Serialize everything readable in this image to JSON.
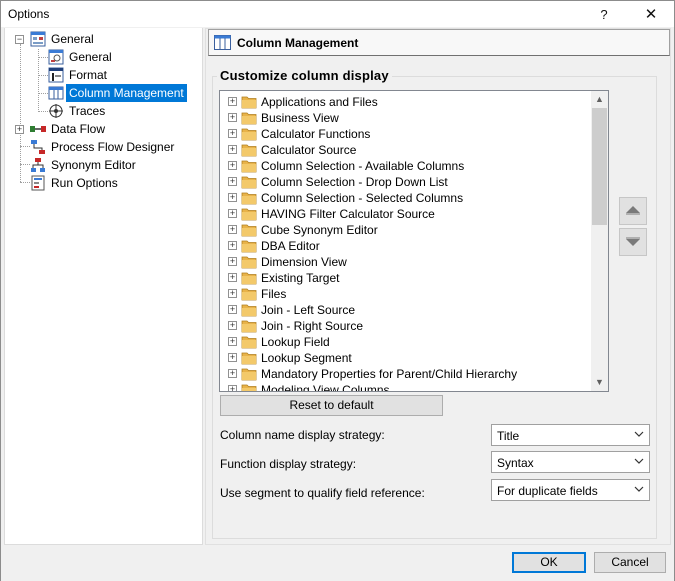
{
  "window": {
    "title": "Options",
    "help_glyph": "?",
    "close_glyph": "✕"
  },
  "tree": {
    "general": "General",
    "general_child": "General",
    "format": "Format",
    "column_management": "Column Management",
    "traces": "Traces",
    "data_flow": "Data Flow",
    "process_flow_designer": "Process Flow Designer",
    "synonym_editor": "Synonym Editor",
    "run_options": "Run Options"
  },
  "header": {
    "title": "Column Management"
  },
  "group": {
    "title": "Customize column display"
  },
  "list": {
    "items": [
      "Applications and Files",
      "Business View",
      "Calculator Functions",
      "Calculator Source",
      "Column Selection - Available Columns",
      "Column Selection - Drop Down List",
      "Column Selection - Selected Columns",
      "HAVING Filter Calculator Source",
      "Cube Synonym Editor",
      "DBA Editor",
      "Dimension View",
      "Existing Target",
      "Files",
      "Join - Left Source",
      "Join - Right Source",
      "Lookup Field",
      "Lookup Segment",
      "Mandatory Properties for Parent/Child Hierarchy",
      "Modeling View Columns"
    ]
  },
  "buttons": {
    "reset": "Reset to default",
    "ok": "OK",
    "cancel": "Cancel"
  },
  "fields": {
    "column_name_label": "Column name display strategy:",
    "column_name_value": "Title",
    "function_label": "Function display strategy:",
    "function_value": "Syntax",
    "segment_label": "Use segment to qualify field reference:",
    "segment_value": "For duplicate fields"
  },
  "colors": {
    "selection": "#0078d7",
    "folder": "#e8b34a",
    "ok_border": "#0078d7"
  }
}
